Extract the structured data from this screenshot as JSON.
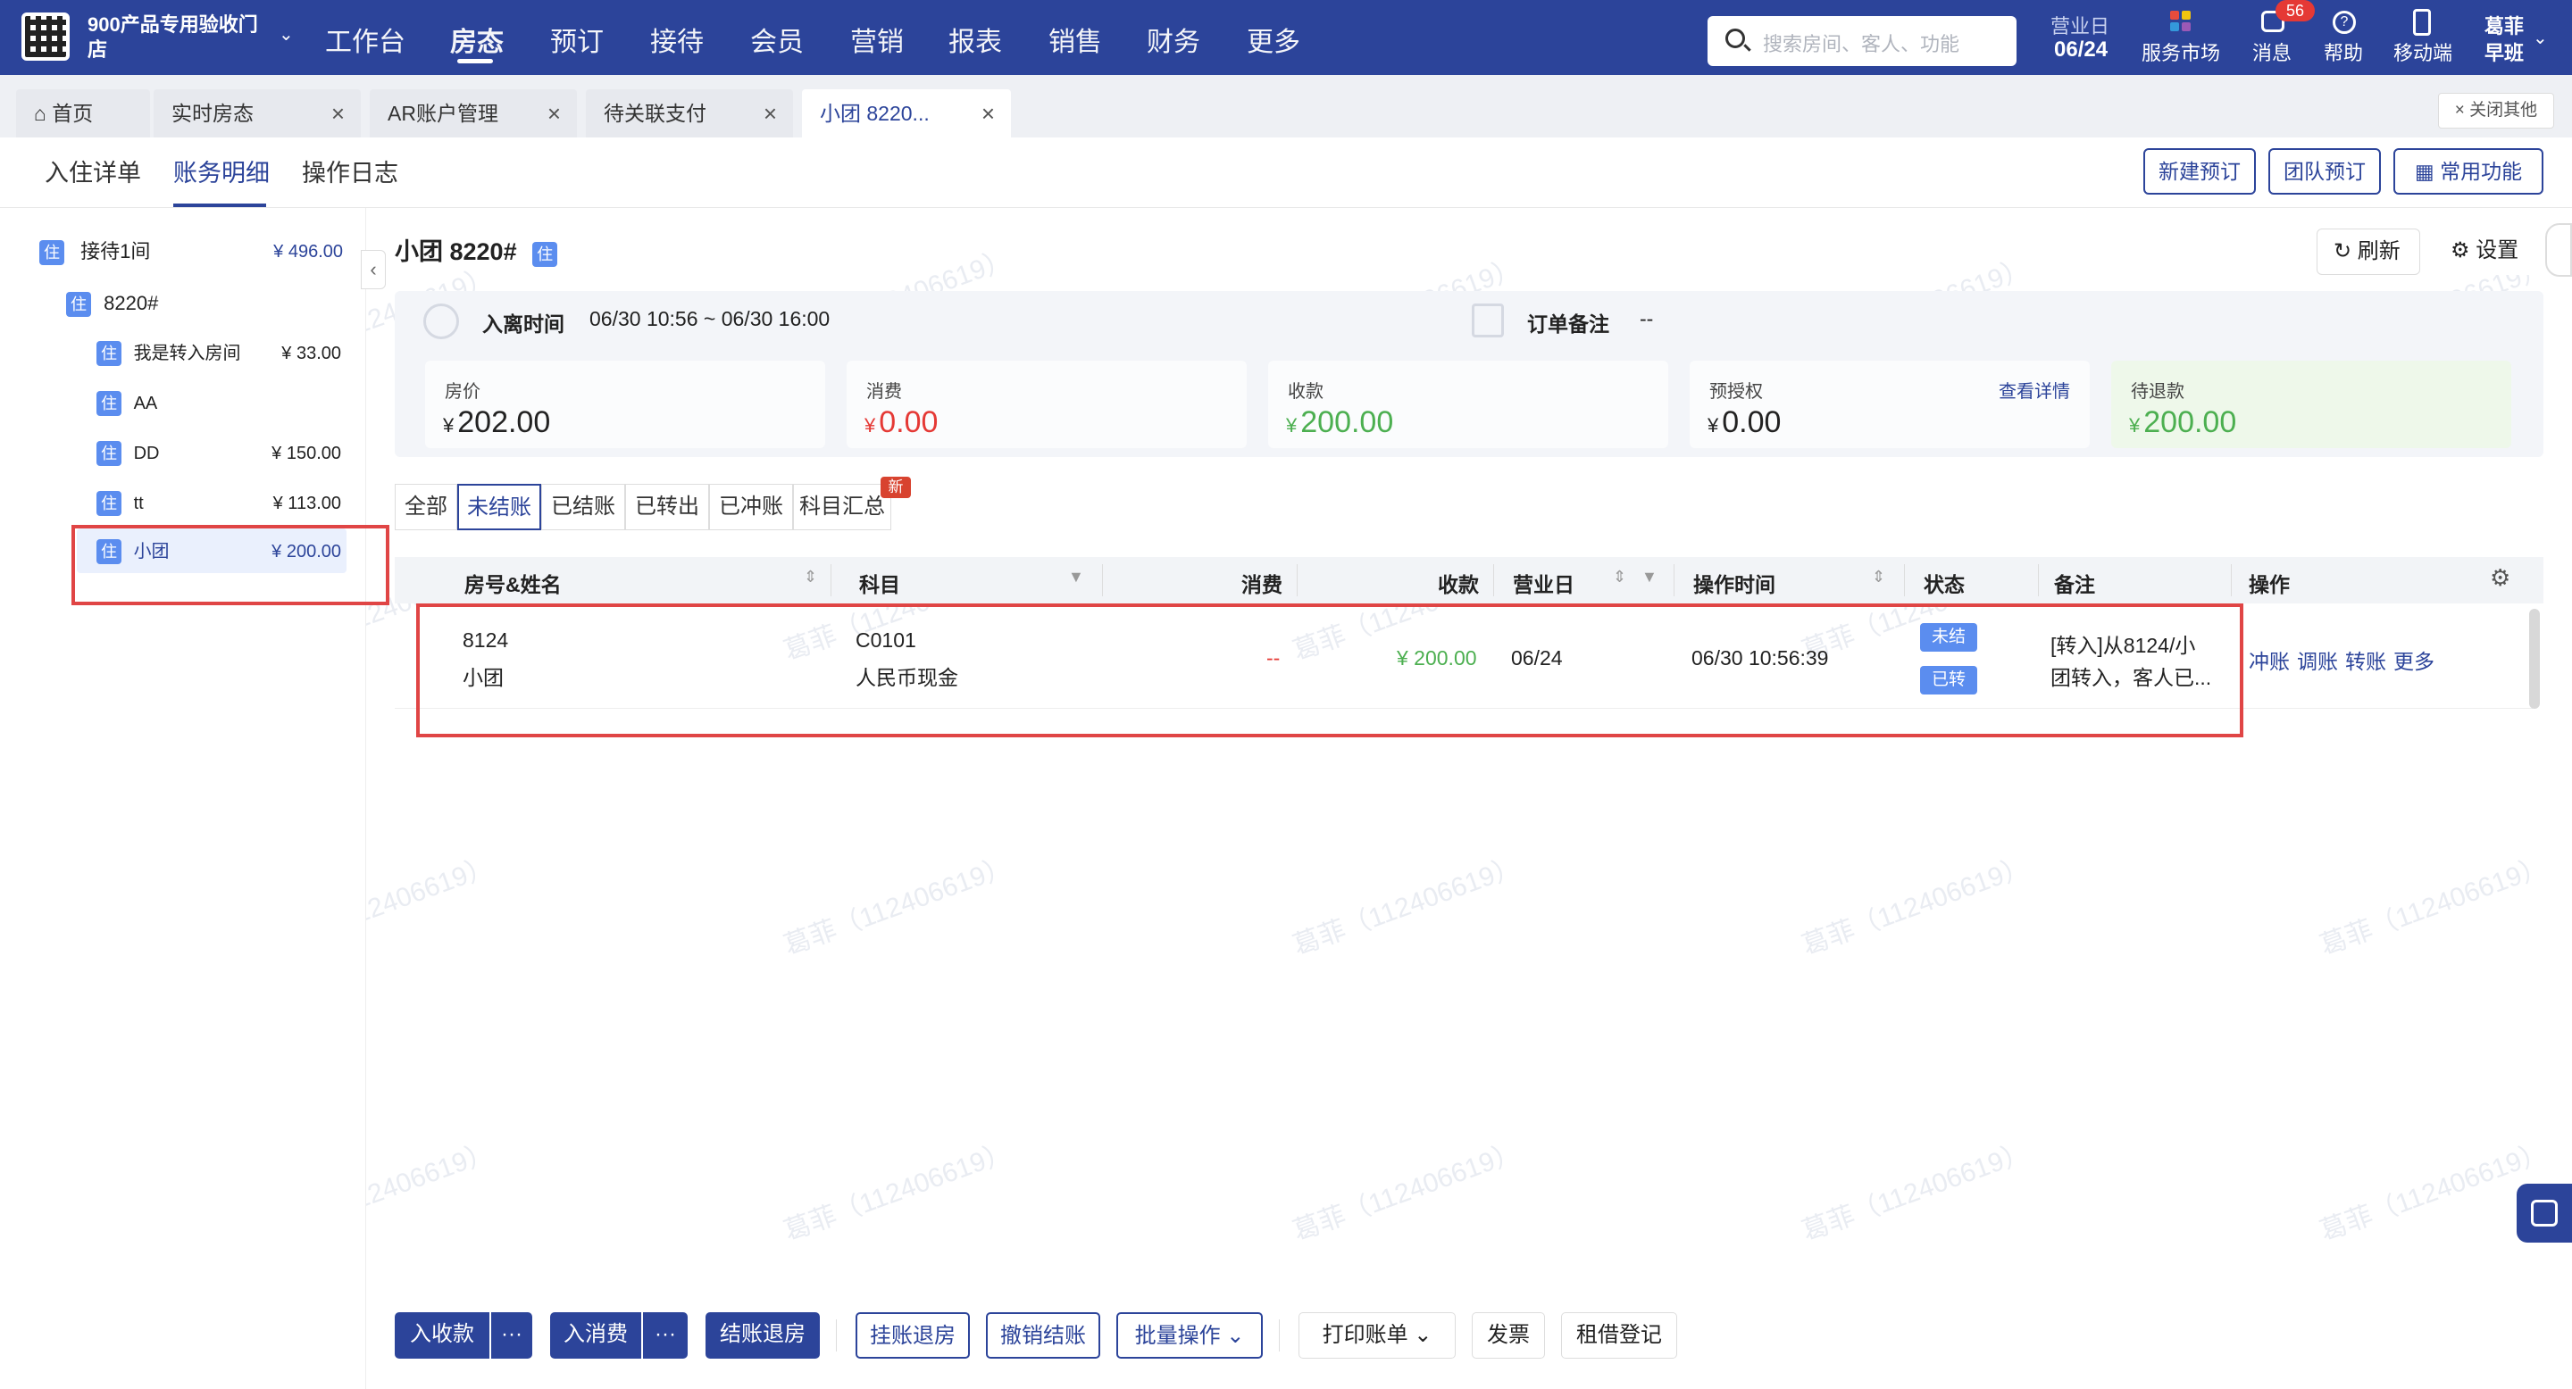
{
  "topbar": {
    "hotel_name": "900产品专用验收门店",
    "nav": [
      "工作台",
      "房态",
      "预订",
      "接待",
      "会员",
      "营销",
      "报表",
      "销售",
      "财务",
      "更多"
    ],
    "active_nav": "房态",
    "search_placeholder": "搜索房间、客人、功能",
    "biz_day_label": "营业日",
    "biz_day": "06/24",
    "service_market": "服务市场",
    "messages": "消息",
    "message_count": "56",
    "help": "帮助",
    "mobile": "移动端",
    "user_name": "葛菲",
    "shift": "早班"
  },
  "tabs": [
    {
      "label": "首页",
      "closable": false
    },
    {
      "label": "实时房态",
      "closable": true
    },
    {
      "label": "AR账户管理",
      "closable": true
    },
    {
      "label": "待关联支付",
      "closable": true
    },
    {
      "label": "小团 8220...",
      "closable": true,
      "active": true
    }
  ],
  "close_others": "关闭其他",
  "subtabs": [
    "入住详单",
    "账务明细",
    "操作日志"
  ],
  "active_subtab": "账务明细",
  "top_buttons": [
    "新建预订",
    "团队预订",
    "常用功能"
  ],
  "tree": {
    "root": {
      "tag": "住",
      "label": "接待1间",
      "amount": "¥ 496.00"
    },
    "room": {
      "tag": "住",
      "label": "8220#"
    },
    "guests": [
      {
        "tag": "住",
        "label": "我是转入房间",
        "amount": "¥ 33.00"
      },
      {
        "tag": "住",
        "label": "AA",
        "amount": ""
      },
      {
        "tag": "住",
        "label": "DD",
        "amount": "¥ 150.00"
      },
      {
        "tag": "住",
        "label": "tt",
        "amount": "¥ 113.00"
      },
      {
        "tag": "住",
        "label": "小团",
        "amount": "¥ 200.00"
      }
    ]
  },
  "main": {
    "title": "小团  8220#",
    "title_tag": "住",
    "refresh": "刷新",
    "settings": "设置",
    "checkin_label": "入离时间",
    "checkin_value": "06/30 10:56 ~ 06/30 16:00",
    "remark_label": "订单备注",
    "remark_value": "--",
    "stats": [
      {
        "label": "房价",
        "cur": "¥",
        "value": "202.00",
        "color": "#222222"
      },
      {
        "label": "消费",
        "cur": "¥",
        "value": "0.00",
        "color": "#e53935"
      },
      {
        "label": "收款",
        "cur": "¥",
        "value": "200.00",
        "color": "#4caf50"
      },
      {
        "label": "预授权",
        "cur": "¥",
        "value": "0.00",
        "color": "#222222",
        "link": "查看详情"
      },
      {
        "label": "待退款",
        "cur": "¥",
        "value": "200.00",
        "color": "#4caf50"
      }
    ],
    "filters": [
      "全部",
      "未结账",
      "已结账",
      "已转出",
      "已冲账",
      "科目汇总"
    ],
    "active_filter": "未结账",
    "new_badge": "新",
    "columns": [
      "房号&姓名",
      "科目",
      "消费",
      "收款",
      "营业日",
      "操作时间",
      "状态",
      "备注",
      "操作"
    ],
    "rows": [
      {
        "room": "8124",
        "name": "小团",
        "code": "C0101",
        "subject": "人民币现金",
        "consume": "--",
        "receive": "¥ 200.00",
        "biz_day": "06/24",
        "op_time": "06/30 10:56:39",
        "status": [
          "未结",
          "已转"
        ],
        "remark_1": "[转入]从8124/小",
        "remark_2": "团转入，客人已...",
        "actions": [
          "冲账",
          "调账",
          "转账",
          "更多"
        ]
      }
    ]
  },
  "bottom": {
    "btn_receive": "入收款",
    "btn_consume": "入消费",
    "btn_checkout": "结账退房",
    "btn_hang": "挂账退房",
    "btn_cancel": "撤销结账",
    "btn_batch": "批量操作",
    "btn_print": "打印账单",
    "btn_invoice": "发票",
    "btn_rent": "租借登记",
    "more": "···"
  },
  "watermark": "葛菲（112406619）",
  "colors": {
    "primary": "#2c449a",
    "tag": "#5b8def",
    "red": "#e53935",
    "green": "#4caf50"
  }
}
